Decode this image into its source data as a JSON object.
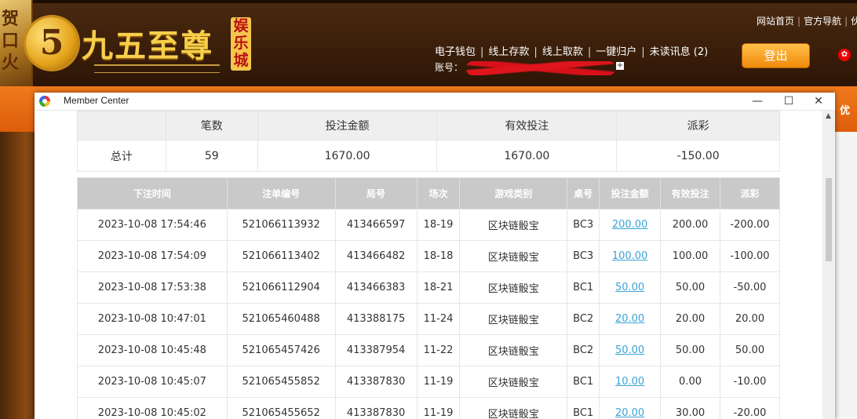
{
  "site": {
    "corner_chars": [
      "贺",
      "口",
      "火"
    ],
    "logo_mark": "5",
    "logo_text": "九五至尊",
    "logo_badge": [
      "娱",
      "乐",
      "城"
    ],
    "top_links": [
      "网站首页",
      "官方导航",
      "伙"
    ],
    "nav": [
      "电子钱包",
      "线上存款",
      "线上取款",
      "一键归户",
      "未读讯息 (2)"
    ],
    "account_prefix": "账号：",
    "login_label": "登出",
    "right_tag": "优"
  },
  "window": {
    "title": "Member Center",
    "minimize": "—",
    "maximize": "☐",
    "close": "✕"
  },
  "summary": {
    "headers": [
      "",
      "笔数",
      "投注金额",
      "有效投注",
      "派彩"
    ],
    "row": {
      "label": "总计",
      "count": "59",
      "bet": "1670.00",
      "valid": "1670.00",
      "payout": "-150.00"
    }
  },
  "bets": {
    "headers": [
      "下注时间",
      "注单编号",
      "局号",
      "场次",
      "游戏类别",
      "桌号",
      "投注金额",
      "有效投注",
      "派彩"
    ],
    "rows": [
      {
        "time": "2023-10-08 17:54:46",
        "order": "521066113932",
        "round": "413466597",
        "session": "18-19",
        "game": "区块链骰宝",
        "table": "BC3",
        "bet": "200.00",
        "valid": "200.00",
        "payout": "-200.00"
      },
      {
        "time": "2023-10-08 17:54:09",
        "order": "521066113402",
        "round": "413466482",
        "session": "18-18",
        "game": "区块链骰宝",
        "table": "BC3",
        "bet": "100.00",
        "valid": "100.00",
        "payout": "-100.00"
      },
      {
        "time": "2023-10-08 17:53:38",
        "order": "521066112904",
        "round": "413466383",
        "session": "18-21",
        "game": "区块链骰宝",
        "table": "BC1",
        "bet": "50.00",
        "valid": "50.00",
        "payout": "-50.00"
      },
      {
        "time": "2023-10-08 10:47:01",
        "order": "521065460488",
        "round": "413388175",
        "session": "11-24",
        "game": "区块链骰宝",
        "table": "BC2",
        "bet": "20.00",
        "valid": "20.00",
        "payout": "20.00"
      },
      {
        "time": "2023-10-08 10:45:48",
        "order": "521065457426",
        "round": "413387954",
        "session": "11-22",
        "game": "区块链骰宝",
        "table": "BC2",
        "bet": "50.00",
        "valid": "50.00",
        "payout": "50.00"
      },
      {
        "time": "2023-10-08 10:45:07",
        "order": "521065455852",
        "round": "413387830",
        "session": "11-19",
        "game": "区块链骰宝",
        "table": "BC1",
        "bet": "10.00",
        "valid": "0.00",
        "payout": "-10.00"
      },
      {
        "time": "2023-10-08 10:45:02",
        "order": "521065455652",
        "round": "413387830",
        "session": "11-19",
        "game": "区块链骰宝",
        "table": "BC1",
        "bet": "20.00",
        "valid": "30.00",
        "payout": "-20.00"
      }
    ]
  },
  "colors": {
    "negative": "#e23b3b",
    "link": "#3aa3d6",
    "header_gray": "#c9c9c9",
    "brand_orange": "#f07a1c"
  }
}
